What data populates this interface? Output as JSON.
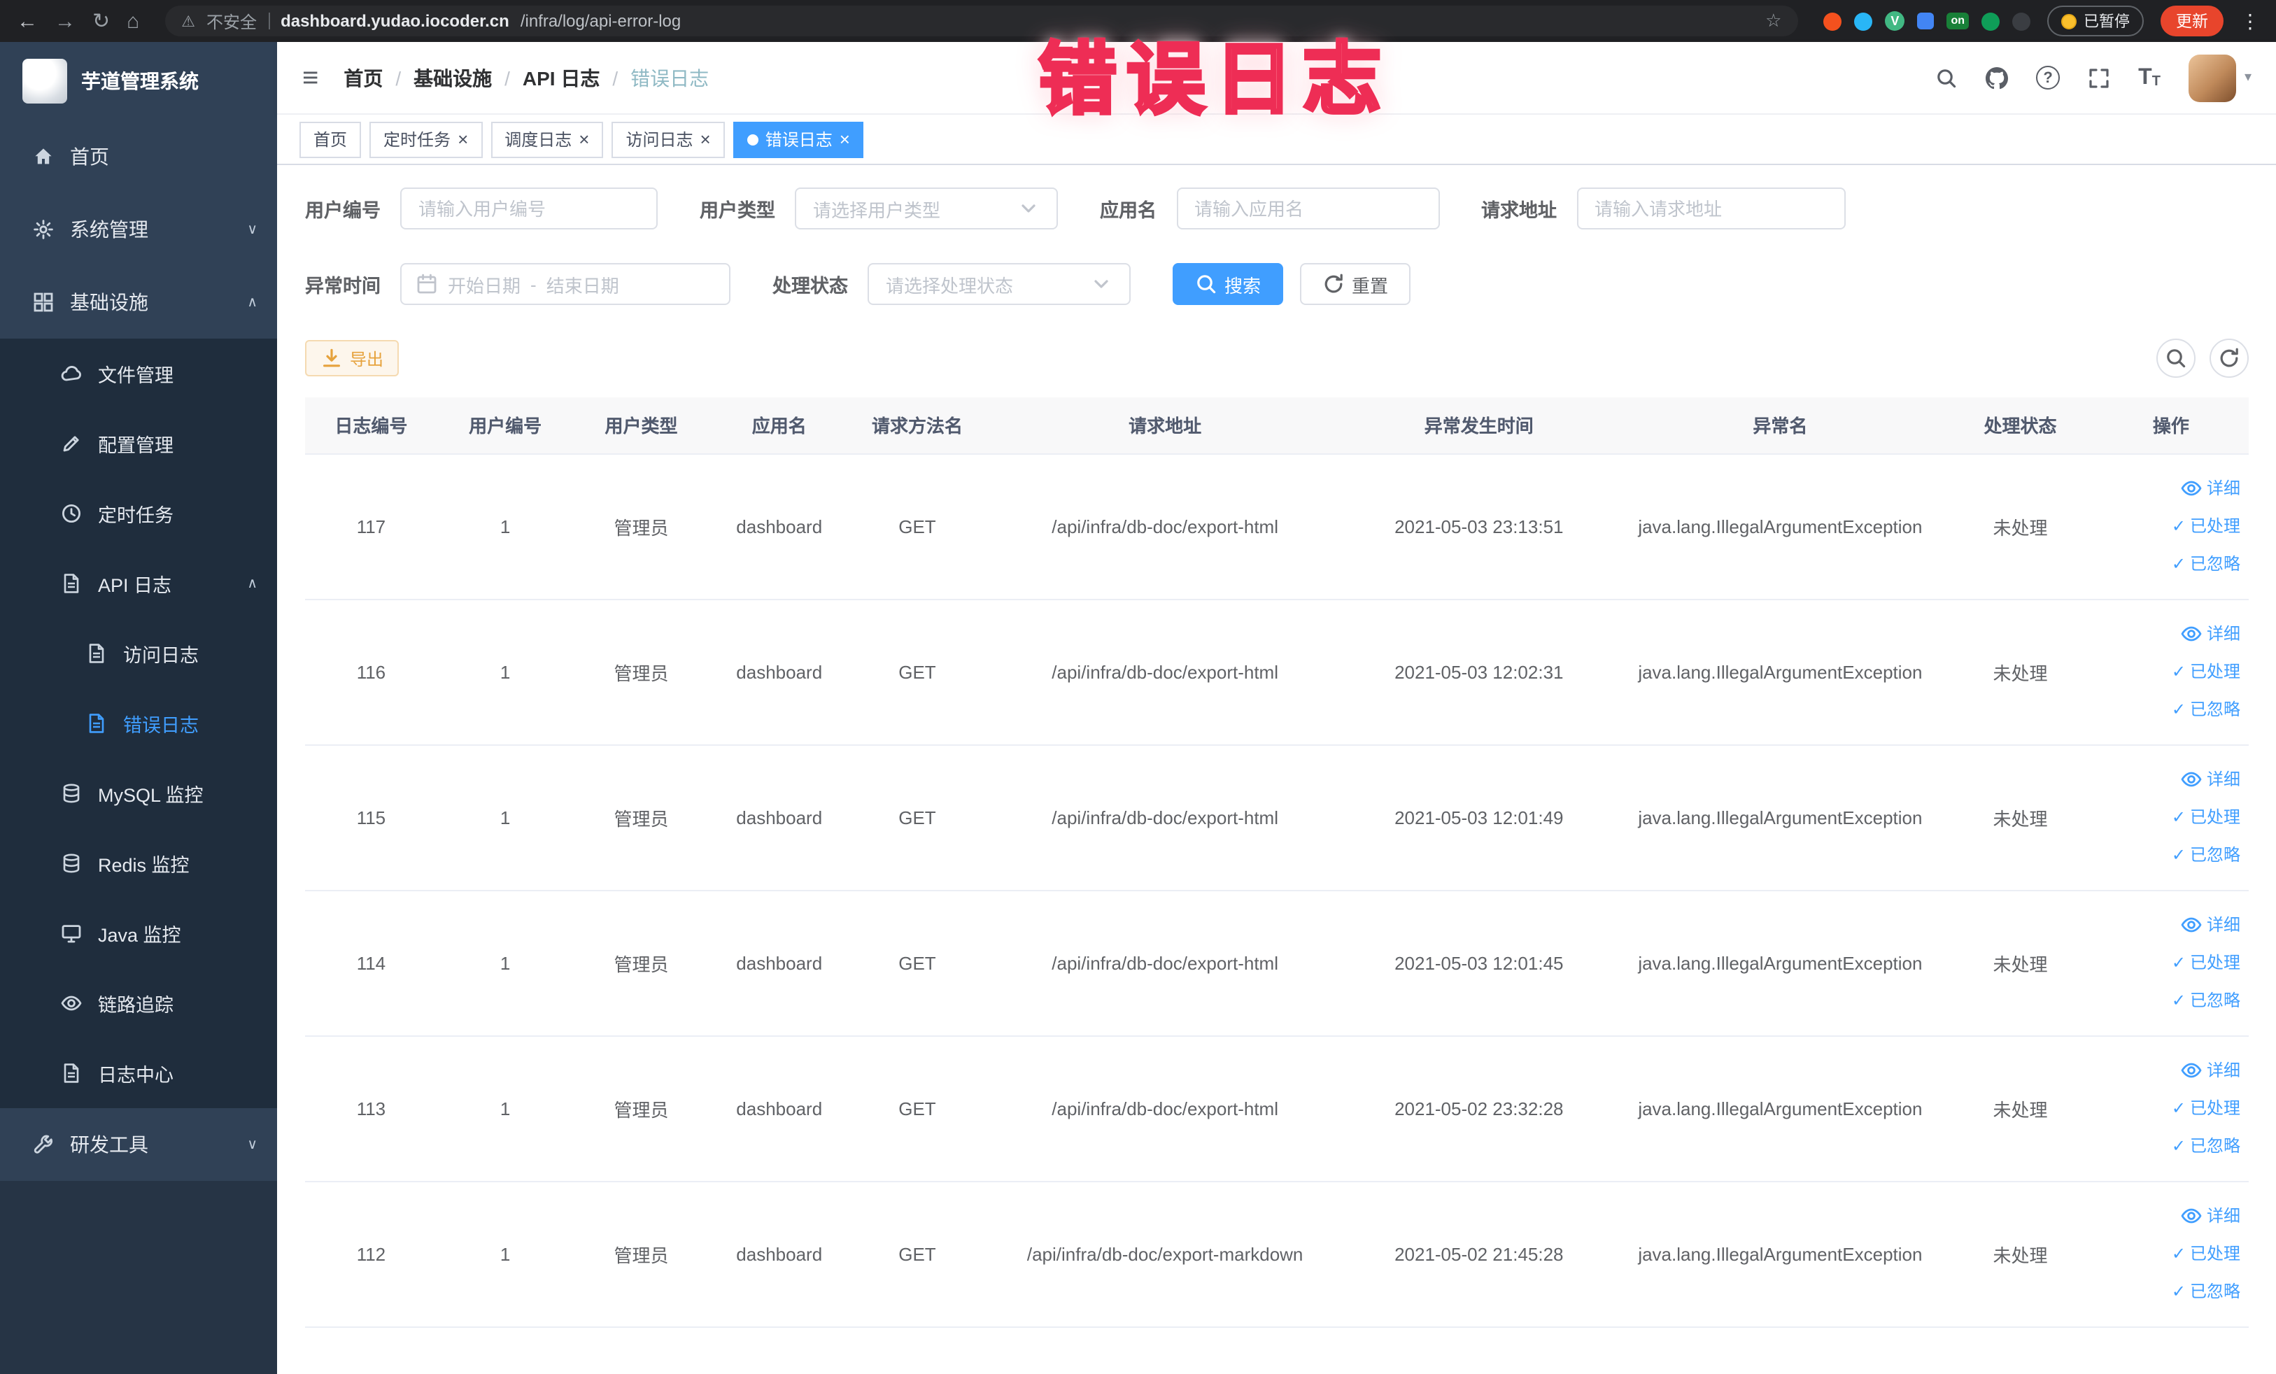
{
  "browser": {
    "security_label": "不安全",
    "url_domain": "dashboard.yudao.iocoder.cn",
    "url_path": "/infra/log/api-error-log",
    "extensions_badge": "on",
    "extension_v_label": "V",
    "paused_badge": "已暂停",
    "update_button": "更新"
  },
  "annotation_overlay": "错误日志",
  "sidebar": {
    "logo_title": "芋道管理系统",
    "items": [
      {
        "label": "首页"
      },
      {
        "label": "系统管理"
      },
      {
        "label": "基础设施"
      },
      {
        "label": "文件管理"
      },
      {
        "label": "配置管理"
      },
      {
        "label": "定时任务"
      },
      {
        "label": "API 日志"
      },
      {
        "label": "访问日志"
      },
      {
        "label": "错误日志"
      },
      {
        "label": "MySQL 监控"
      },
      {
        "label": "Redis 监控"
      },
      {
        "label": "Java 监控"
      },
      {
        "label": "链路追踪"
      },
      {
        "label": "日志中心"
      },
      {
        "label": "研发工具"
      }
    ]
  },
  "breadcrumb": {
    "separator": "/",
    "items": [
      {
        "label": "首页"
      },
      {
        "label": "基础设施"
      },
      {
        "label": "API 日志"
      },
      {
        "label": "错误日志"
      }
    ]
  },
  "tabs": [
    {
      "label": "首页"
    },
    {
      "label": "定时任务"
    },
    {
      "label": "调度日志"
    },
    {
      "label": "访问日志"
    },
    {
      "label": "错误日志"
    }
  ],
  "filters": {
    "user_id": {
      "label": "用户编号",
      "placeholder": "请输入用户编号"
    },
    "user_type": {
      "label": "用户类型",
      "placeholder": "请选择用户类型"
    },
    "app_name": {
      "label": "应用名",
      "placeholder": "请输入应用名"
    },
    "request_url": {
      "label": "请求地址",
      "placeholder": "请输入请求地址"
    },
    "exception_time": {
      "label": "异常时间",
      "start_placeholder": "开始日期",
      "separator": "-",
      "end_placeholder": "结束日期"
    },
    "process_status": {
      "label": "处理状态",
      "placeholder": "请选择处理状态"
    },
    "search_button": "搜索",
    "reset_button": "重置"
  },
  "toolbar": {
    "export_button": "导出"
  },
  "table": {
    "columns": [
      "日志编号",
      "用户编号",
      "用户类型",
      "应用名",
      "请求方法名",
      "请求地址",
      "异常发生时间",
      "异常名",
      "处理状态",
      "操作"
    ],
    "actions": {
      "detail": "详细",
      "processed": "已处理",
      "ignored": "已忽略"
    },
    "rows": [
      {
        "id": "117",
        "user_id": "1",
        "user_type": "管理员",
        "app": "dashboard",
        "method": "GET",
        "url": "/api/infra/db-doc/export-html",
        "time": "2021-05-03 23:13:51",
        "exception": "java.lang.IllegalArgumentException",
        "status": "未处理"
      },
      {
        "id": "116",
        "user_id": "1",
        "user_type": "管理员",
        "app": "dashboard",
        "method": "GET",
        "url": "/api/infra/db-doc/export-html",
        "time": "2021-05-03 12:02:31",
        "exception": "java.lang.IllegalArgumentException",
        "status": "未处理"
      },
      {
        "id": "115",
        "user_id": "1",
        "user_type": "管理员",
        "app": "dashboard",
        "method": "GET",
        "url": "/api/infra/db-doc/export-html",
        "time": "2021-05-03 12:01:49",
        "exception": "java.lang.IllegalArgumentException",
        "status": "未处理"
      },
      {
        "id": "114",
        "user_id": "1",
        "user_type": "管理员",
        "app": "dashboard",
        "method": "GET",
        "url": "/api/infra/db-doc/export-html",
        "time": "2021-05-03 12:01:45",
        "exception": "java.lang.IllegalArgumentException",
        "status": "未处理"
      },
      {
        "id": "113",
        "user_id": "1",
        "user_type": "管理员",
        "app": "dashboard",
        "method": "GET",
        "url": "/api/infra/db-doc/export-html",
        "time": "2021-05-02 23:32:28",
        "exception": "java.lang.IllegalArgumentException",
        "status": "未处理"
      },
      {
        "id": "112",
        "user_id": "1",
        "user_type": "管理员",
        "app": "dashboard",
        "method": "GET",
        "url": "/api/infra/db-doc/export-markdown",
        "time": "2021-05-02 21:45:28",
        "exception": "java.lang.IllegalArgumentException",
        "status": "未处理"
      }
    ]
  },
  "icons": {
    "back": "←",
    "forward": "→",
    "reload": "↻",
    "home": "⌂",
    "warning": "⚠",
    "star": "☆",
    "kebab": "⋮",
    "hamburger": "≡",
    "question": "?",
    "caret_down": "▾",
    "chevron_collapsed": "∨",
    "chevron_expanded": "∧",
    "check": "✓",
    "close": "×",
    "font_large": "T",
    "font_small": "T"
  }
}
